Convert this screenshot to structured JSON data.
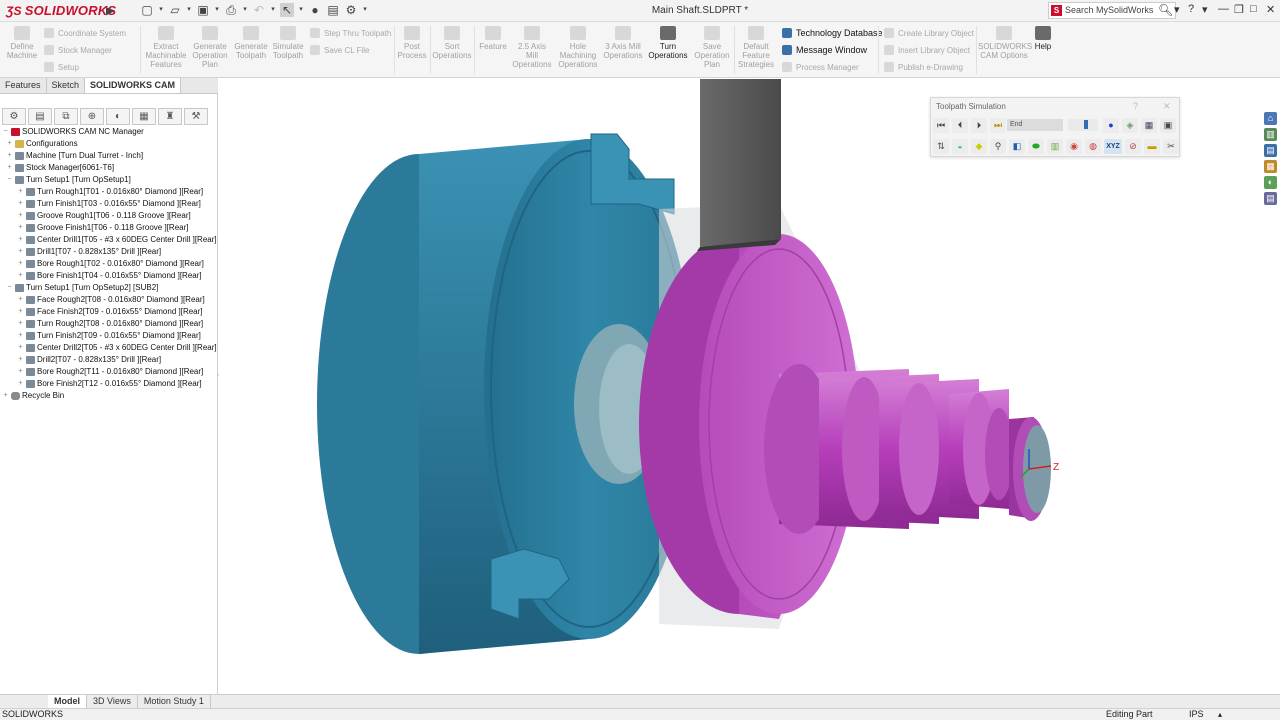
{
  "app": {
    "brand": "SOLIDWORKS",
    "document_title": "Main Shaft.SLDPRT *",
    "search_placeholder": "Search MySolidWorks"
  },
  "ribbon": {
    "define_machine": "Define Machine",
    "coordinate_system": "Coordinate System",
    "stock_manager": "Stock Manager",
    "setup": "Setup",
    "extract_features": "Extract Machinable Features",
    "generate_plan": "Generate Operation Plan",
    "generate_toolpath": "Generate Toolpath",
    "simulate_toolpath": "Simulate Toolpath",
    "step_thru": "Step Thru Toolpath",
    "save_cl": "Save CL File",
    "post_process": "Post Process",
    "sort_operations": "Sort Operations",
    "feature": "Feature",
    "mill_25": "2.5 Axis Mill Operations",
    "hole_machining": "Hole Machining Operations",
    "mill_3": "3 Axis Mill Operations",
    "turn_operations": "Turn Operations",
    "save_plan": "Save Operation Plan",
    "default_strategies": "Default Feature Strategies",
    "technology_database": "Technology Database",
    "message_window": "Message Window",
    "process_manager": "Process Manager",
    "create_library": "Create Library Object",
    "insert_library": "Insert Library Object",
    "publish_edrawing": "Publish e-Drawing",
    "cam_options": "SOLIDWORKS CAM Options",
    "help": "Help"
  },
  "manager_tabs": [
    "Features",
    "Sketch",
    "SOLIDWORKS CAM"
  ],
  "tree": [
    {
      "label": "SOLIDWORKS CAM NC Manager",
      "level": 0,
      "icon": "root"
    },
    {
      "label": "Configurations",
      "level": 1,
      "icon": "folder"
    },
    {
      "label": "Machine [Turn Dual Turret - Inch]",
      "level": 1,
      "icon": "machine"
    },
    {
      "label": "Stock Manager[6061-T6]",
      "level": 1,
      "icon": "stock"
    },
    {
      "label": "Turn Setup1 [Turn OpSetup1]",
      "level": 1,
      "icon": "setup"
    },
    {
      "label": "Turn Rough1[T01 - 0.016x80° Diamond ][Rear]",
      "level": 2,
      "icon": "op"
    },
    {
      "label": "Turn Finish1[T03 - 0.016x55° Diamond ][Rear]",
      "level": 2,
      "icon": "op"
    },
    {
      "label": "Groove Rough1[T06 - 0.118 Groove ][Rear]",
      "level": 2,
      "icon": "op"
    },
    {
      "label": "Groove Finish1[T06 - 0.118 Groove ][Rear]",
      "level": 2,
      "icon": "op"
    },
    {
      "label": "Center Drill1[T05 - #3 x 60DEG Center Drill ][Rear]",
      "level": 2,
      "icon": "op"
    },
    {
      "label": "Drill1[T07 - 0.828x135° Drill ][Rear]",
      "level": 2,
      "icon": "op"
    },
    {
      "label": "Bore Rough1[T02 - 0.016x80° Diamond ][Rear]",
      "level": 2,
      "icon": "op"
    },
    {
      "label": "Bore Finish1[T04 - 0.016x55° Diamond ][Rear]",
      "level": 2,
      "icon": "op"
    },
    {
      "label": "Turn Setup1 [Turn OpSetup2] [SUB2]",
      "level": 1,
      "icon": "setup"
    },
    {
      "label": "Face Rough2[T08 - 0.016x80° Diamond ][Rear]",
      "level": 2,
      "icon": "op"
    },
    {
      "label": "Face Finish2[T09 - 0.016x55° Diamond ][Rear]",
      "level": 2,
      "icon": "op"
    },
    {
      "label": "Turn Rough2[T08 - 0.016x80° Diamond ][Rear]",
      "level": 2,
      "icon": "op"
    },
    {
      "label": "Turn Finish2[T09 - 0.016x55° Diamond ][Rear]",
      "level": 2,
      "icon": "op"
    },
    {
      "label": "Center Drill2[T05 - #3 x 60DEG Center Drill ][Rear]",
      "level": 2,
      "icon": "op"
    },
    {
      "label": "Drill2[T07 - 0.828x135° Drill ][Rear]",
      "level": 2,
      "icon": "op"
    },
    {
      "label": "Bore Rough2[T11 - 0.016x80° Diamond ][Rear]",
      "level": 2,
      "icon": "op"
    },
    {
      "label": "Bore Finish2[T12 - 0.016x55° Diamond ][Rear]",
      "level": 2,
      "icon": "op"
    },
    {
      "label": "Recycle Bin",
      "level": 0,
      "icon": "bin"
    }
  ],
  "toolpath_sim": {
    "title": "Toolpath Simulation",
    "end_label": "End",
    "help": "?",
    "close": "✕",
    "xyz_label": "XYZ"
  },
  "bottom_tabs": [
    "Model",
    "3D Views",
    "Motion Study 1"
  ],
  "status": {
    "app": "SOLIDWORKS",
    "mode": "Editing Part",
    "units": "IPS"
  },
  "triad": {
    "z_label": "Z"
  },
  "colors": {
    "chuck": "#2e7fa0",
    "part": "#c14fc4",
    "tool": "#5a5a5a",
    "brand_red": "#c8102e"
  }
}
